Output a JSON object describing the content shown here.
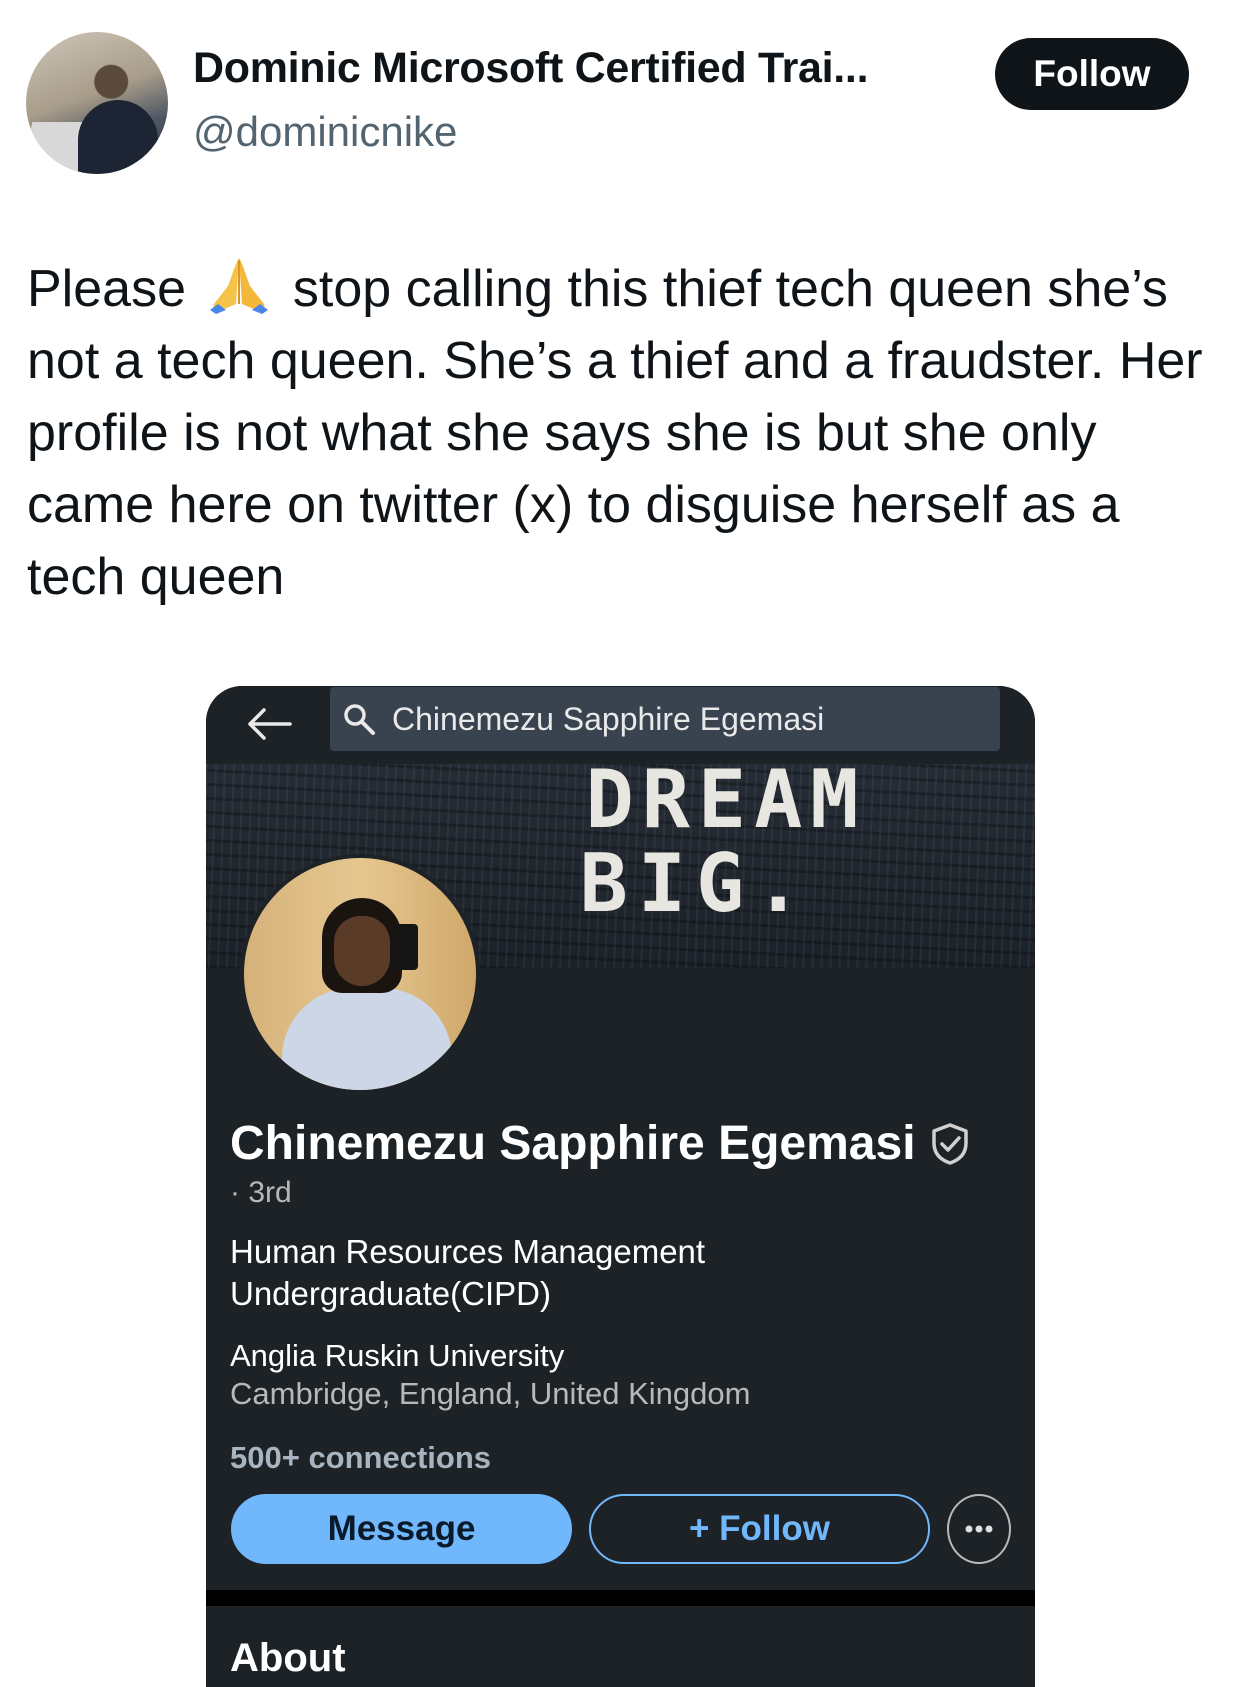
{
  "tweet": {
    "author_name": "Dominic Microsoft Certified Trai...",
    "author_handle": "@dominicnike",
    "follow_label": "Follow",
    "text_before_emoji": "Please",
    "emoji": "folded-hands-icon",
    "text_after_emoji": "stop calling this thief tech queen she’s not a tech queen. She’s a thief and a fraudster. Her profile is not what she says she is but she only came here on twitter (x) to disguise herself as a tech queen"
  },
  "embedded_profile": {
    "search_text": "Chinemezu Sapphire Egemasi",
    "banner_line1": "DREAM",
    "banner_line2": "BIG.",
    "name": "Chinemezu Sapphire Egemasi",
    "degree": "· 3rd",
    "headline": "Human Resources Management Undergraduate(CIPD)",
    "school": "Anglia Ruskin University",
    "location": "Cambridge, England, United Kingdom",
    "connections": "500+ connections",
    "message_label": "Message",
    "follow_label": "+ Follow",
    "section_title": "About",
    "colors": {
      "background": "#1d2226",
      "accent": "#71b7fb"
    }
  }
}
